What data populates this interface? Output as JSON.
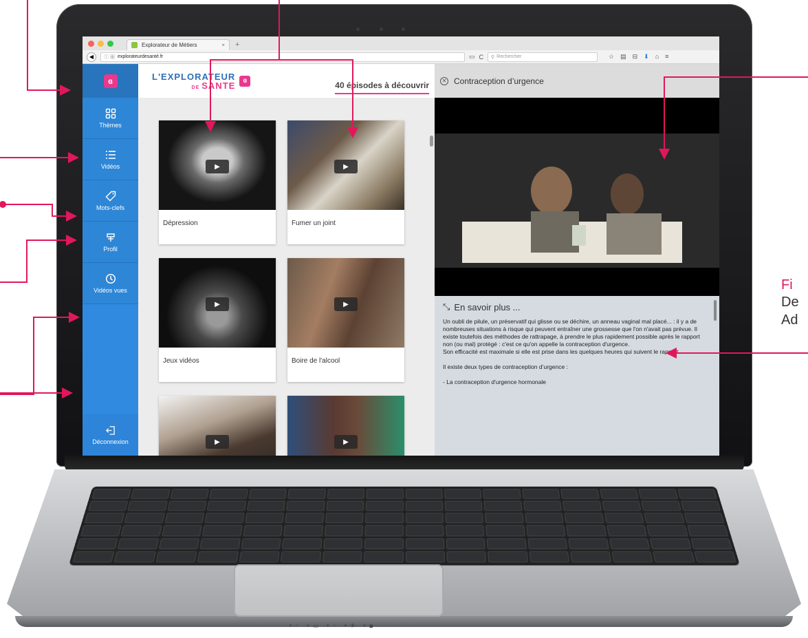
{
  "browser": {
    "tab_title": "Explorateur de Métiers",
    "tab_close": "×",
    "tab_new": "+",
    "url": "explorateurdesanté.fr",
    "search_placeholder": "Rechercher"
  },
  "sidebar": {
    "items": [
      {
        "label": "Thèmes",
        "icon": "grid-icon"
      },
      {
        "label": "Vidéos",
        "icon": "list-icon"
      },
      {
        "label": "Mots-clefs",
        "icon": "tag-icon"
      },
      {
        "label": "Profil",
        "icon": "profile-icon"
      },
      {
        "label": "Vidéos vues",
        "icon": "clock-icon"
      }
    ],
    "logout_label": "Déconnexion"
  },
  "catalog": {
    "brand_line1": "L'EXPLORATEUR",
    "brand_line2_small": "DE",
    "brand_line2": "SANTE",
    "episodes_count_label": "40 épisodes à découvrir",
    "cards": [
      {
        "title": "Dépression"
      },
      {
        "title": "Fumer un joint"
      },
      {
        "title": "Jeux vidéos"
      },
      {
        "title": "Boire de l'alcool"
      },
      {
        "title": ""
      },
      {
        "title": ""
      }
    ]
  },
  "detail": {
    "title": "Contraception d’urgence",
    "more_title": "En savoir plus ...",
    "paragraph1": "Un oubli de pilule, un préservatif qui glisse ou se déchire, un anneau vaginal mal placé... : il y a de nombreuses situations à risque qui peuvent entraîner une grossesse que l'on n'avait pas prévue. Il existe toutefois des méthodes de rattrapage, à prendre le plus rapidement possible après le rapport non (ou mal) protégé : c'est ce qu'on appelle la contraception d'urgence.",
    "paragraph2": "Son efficacité est maximale si elle est prise dans les quelques heures qui suivent le rapport.",
    "paragraph3": "Il existe deux types de contraception d’urgence :",
    "paragraph4": "- La contraception d'urgence hormonale"
  },
  "annotation": {
    "fig_label": "Fi",
    "fig_line2": "De",
    "fig_line3": "Ad",
    "color": "#e0185a"
  },
  "colors": {
    "sidebar": "#2e86d6",
    "accent": "#e9398d",
    "annotation": "#e0185a"
  }
}
